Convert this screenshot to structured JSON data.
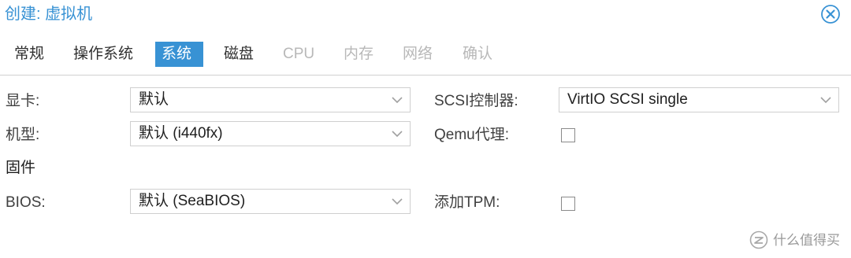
{
  "window": {
    "title": "创建: 虚拟机"
  },
  "tabs": [
    {
      "label": "常规",
      "state": "normal"
    },
    {
      "label": "操作系统",
      "state": "normal"
    },
    {
      "label": "系统",
      "state": "active"
    },
    {
      "label": "磁盘",
      "state": "normal"
    },
    {
      "label": "CPU",
      "state": "disabled"
    },
    {
      "label": "内存",
      "state": "disabled"
    },
    {
      "label": "网络",
      "state": "disabled"
    },
    {
      "label": "确认",
      "state": "disabled"
    }
  ],
  "form": {
    "graphics_label": "显卡:",
    "graphics_value": "默认",
    "machine_label": "机型:",
    "machine_value": "默认 (i440fx)",
    "firmware_section": "固件",
    "bios_label": "BIOS:",
    "bios_value": "默认 (SeaBIOS)",
    "scsi_label": "SCSI控制器:",
    "scsi_value": "VirtIO SCSI single",
    "qemu_agent_label": "Qemu代理:",
    "qemu_agent_checked": false,
    "tpm_label": "添加TPM:",
    "tpm_checked": false
  },
  "watermark": {
    "text": "什么值得买"
  },
  "colors": {
    "accent": "#3892d4",
    "disabled_text": "#b8b8b8",
    "border": "#cfcfcf"
  },
  "icons": {
    "close": "close-circle-icon",
    "dropdown": "chevron-down-icon"
  }
}
